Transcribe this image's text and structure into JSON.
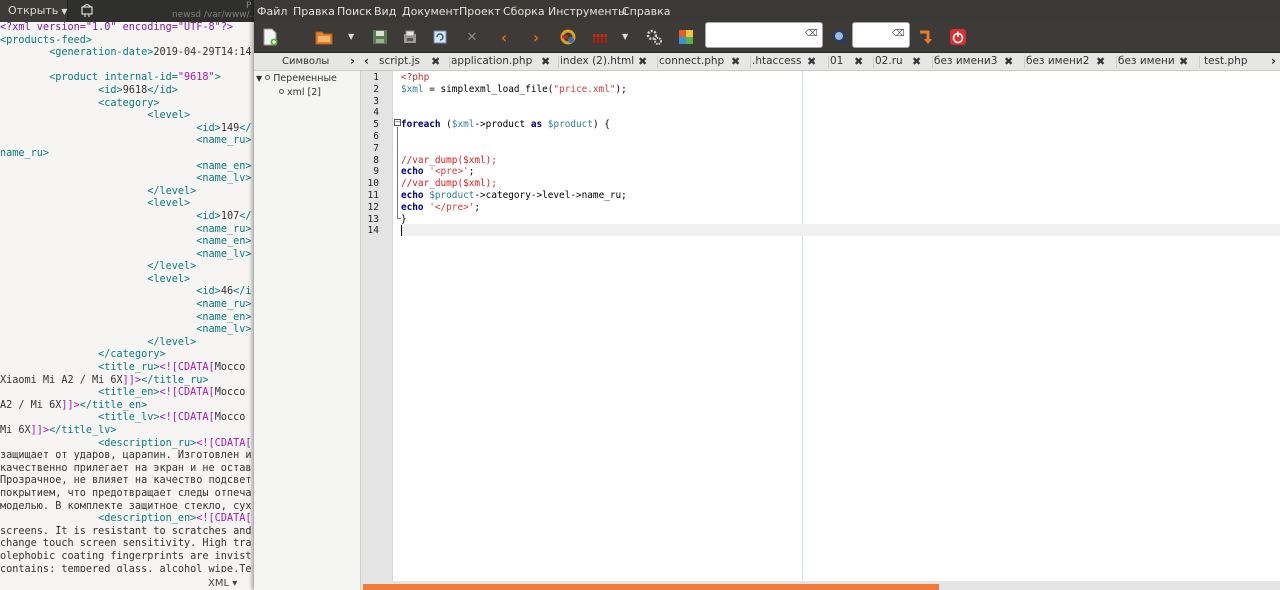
{
  "back_window": {
    "open_button": "Открыть",
    "path_text": "newsd /var/www/...",
    "title_fragment": "Р",
    "language": "XML ▾",
    "xml_lines": [
      {
        "s": [
          [
            "t-pi",
            "<?xml version=\"1.0\" encoding=\"UTF-8\"?>"
          ]
        ]
      },
      {
        "s": [
          [
            "t-tag",
            "<products-feed>"
          ]
        ]
      },
      {
        "s": [
          [
            "t-plain",
            "        "
          ],
          [
            "t-tag",
            "<generation-date>"
          ],
          [
            "t-plain",
            "2019-04-29T14:14"
          ]
        ]
      },
      {
        "s": [
          [
            "t-plain",
            ""
          ]
        ]
      },
      {
        "s": [
          [
            "t-plain",
            "        "
          ],
          [
            "t-tag",
            "<product "
          ],
          [
            "t-attr",
            "internal-id="
          ],
          [
            "t-str",
            "\"9618\""
          ],
          [
            "t-tag",
            ">"
          ]
        ]
      },
      {
        "s": [
          [
            "t-plain",
            "                "
          ],
          [
            "t-tag",
            "<id>"
          ],
          [
            "t-plain",
            "9618"
          ],
          [
            "t-tag",
            "</id>"
          ]
        ]
      },
      {
        "s": [
          [
            "t-plain",
            "                "
          ],
          [
            "t-tag",
            "<category>"
          ]
        ]
      },
      {
        "s": [
          [
            "t-plain",
            "                        "
          ],
          [
            "t-tag",
            "<level>"
          ]
        ]
      },
      {
        "s": [
          [
            "t-plain",
            "                                "
          ],
          [
            "t-tag",
            "<id>"
          ],
          [
            "t-plain",
            "149"
          ],
          [
            "t-tag",
            "</"
          ]
        ]
      },
      {
        "s": [
          [
            "t-plain",
            "                                "
          ],
          [
            "t-tag",
            "<name_ru>"
          ]
        ]
      },
      {
        "s": [
          [
            "t-tag",
            "name_ru>"
          ]
        ]
      },
      {
        "s": [
          [
            "t-plain",
            "                                "
          ],
          [
            "t-tag",
            "<name_en>"
          ]
        ]
      },
      {
        "s": [
          [
            "t-plain",
            "                                "
          ],
          [
            "t-tag",
            "<name_lv>"
          ]
        ]
      },
      {
        "s": [
          [
            "t-plain",
            "                        "
          ],
          [
            "t-tag",
            "</level>"
          ]
        ]
      },
      {
        "s": [
          [
            "t-plain",
            "                        "
          ],
          [
            "t-tag",
            "<level>"
          ]
        ]
      },
      {
        "s": [
          [
            "t-plain",
            "                                "
          ],
          [
            "t-tag",
            "<id>"
          ],
          [
            "t-plain",
            "107"
          ],
          [
            "t-tag",
            "</"
          ]
        ]
      },
      {
        "s": [
          [
            "t-plain",
            "                                "
          ],
          [
            "t-tag",
            "<name_ru>"
          ]
        ]
      },
      {
        "s": [
          [
            "t-plain",
            "                                "
          ],
          [
            "t-tag",
            "<name_en>"
          ]
        ]
      },
      {
        "s": [
          [
            "t-plain",
            "                                "
          ],
          [
            "t-tag",
            "<name_lv>"
          ]
        ]
      },
      {
        "s": [
          [
            "t-plain",
            "                        "
          ],
          [
            "t-tag",
            "</level>"
          ]
        ]
      },
      {
        "s": [
          [
            "t-plain",
            "                        "
          ],
          [
            "t-tag",
            "<level>"
          ]
        ]
      },
      {
        "s": [
          [
            "t-plain",
            "                                "
          ],
          [
            "t-tag",
            "<id>"
          ],
          [
            "t-plain",
            "46"
          ],
          [
            "t-tag",
            "</i"
          ]
        ]
      },
      {
        "s": [
          [
            "t-plain",
            "                                "
          ],
          [
            "t-tag",
            "<name_ru>"
          ]
        ]
      },
      {
        "s": [
          [
            "t-plain",
            "                                "
          ],
          [
            "t-tag",
            "<name_en>"
          ]
        ]
      },
      {
        "s": [
          [
            "t-plain",
            "                                "
          ],
          [
            "t-tag",
            "<name_lv>"
          ]
        ]
      },
      {
        "s": [
          [
            "t-plain",
            "                        "
          ],
          [
            "t-tag",
            "</level>"
          ]
        ]
      },
      {
        "s": [
          [
            "t-plain",
            "                "
          ],
          [
            "t-tag",
            "</category>"
          ]
        ]
      },
      {
        "s": [
          [
            "t-plain",
            "                "
          ],
          [
            "t-tag",
            "<title_ru>"
          ],
          [
            "t-cdata",
            "<![CDATA["
          ],
          [
            "t-plain",
            "Моссо"
          ]
        ]
      },
      {
        "s": [
          [
            "t-plain",
            "Xiaomi Mi A2 / Mi 6X"
          ],
          [
            "t-cdata",
            "]]>"
          ],
          [
            "t-tag",
            "</title_ru>"
          ]
        ]
      },
      {
        "s": [
          [
            "t-plain",
            "                "
          ],
          [
            "t-tag",
            "<title_en>"
          ],
          [
            "t-cdata",
            "<![CDATA["
          ],
          [
            "t-plain",
            "Mocco"
          ]
        ]
      },
      {
        "s": [
          [
            "t-plain",
            "A2 / Mi 6X"
          ],
          [
            "t-cdata",
            "]]>"
          ],
          [
            "t-tag",
            "</title_en>"
          ]
        ]
      },
      {
        "s": [
          [
            "t-plain",
            "                "
          ],
          [
            "t-tag",
            "<title_lv>"
          ],
          [
            "t-cdata",
            "<![CDATA["
          ],
          [
            "t-plain",
            "Mocco"
          ]
        ]
      },
      {
        "s": [
          [
            "t-plain",
            "Mi 6X"
          ],
          [
            "t-cdata",
            "]]>"
          ],
          [
            "t-tag",
            "</title_lv>"
          ]
        ]
      },
      {
        "s": [
          [
            "t-plain",
            "                "
          ],
          [
            "t-tag",
            "<description_ru>"
          ],
          [
            "t-cdata",
            "<![CDATA["
          ]
        ]
      },
      {
        "s": [
          [
            "t-plain",
            "защищает от ударов, царапин. Изготовлен и"
          ]
        ]
      },
      {
        "s": [
          [
            "t-plain",
            "качественно прилегает на экран и не остав"
          ]
        ]
      },
      {
        "s": [
          [
            "t-plain",
            "Прозрачное, не влияет на качество подсвет"
          ]
        ]
      },
      {
        "s": [
          [
            "t-plain",
            "покрытием, что предотвращает следы отпеча"
          ]
        ]
      },
      {
        "s": [
          [
            "t-plain",
            "моделью. В комплекте защитное стекло, сух"
          ]
        ]
      },
      {
        "s": [
          [
            "t-plain",
            "                "
          ],
          [
            "t-tag",
            "<description_en>"
          ],
          [
            "t-cdata",
            "<![CDATA["
          ]
        ]
      },
      {
        "s": [
          [
            "t-plain",
            "screens. It is resistant to scratches and"
          ]
        ]
      },
      {
        "s": [
          [
            "t-plain",
            "change touch screen sensitivity. High tra"
          ]
        ]
      },
      {
        "s": [
          [
            "t-plain",
            "olephobic coating fingerprints are invist"
          ]
        ]
      },
      {
        "s": [
          [
            "t-plain",
            "contains: tempered glass, alcohol wipe.Te"
          ]
        ]
      }
    ]
  },
  "menubar": {
    "items": [
      "Файл",
      "Правка",
      "Поиск",
      "Вид",
      "Документ",
      "Проект",
      "Сборка",
      "Инструменты",
      "Справка"
    ]
  },
  "toolbar": {
    "search_value": "",
    "goto_value": ""
  },
  "sidebar": {
    "tab_label": "Символы",
    "tree_root": "Переменные",
    "tree_child": "xml [2]"
  },
  "tabs": [
    "script.js",
    "application.php",
    "index (2).html",
    "connect.php",
    ".htaccess",
    "01",
    "02.ru",
    "без имени3",
    "без имени2",
    "без имени",
    "test.php"
  ],
  "editor": {
    "line_numbers": [
      "1",
      "2",
      "3",
      "4",
      "5",
      "6",
      "7",
      "8",
      "9",
      "10",
      "11",
      "12",
      "13",
      "14"
    ],
    "lines": [
      {
        "s": [
          [
            "c-php",
            "<?php"
          ]
        ]
      },
      {
        "s": [
          [
            "c-var",
            "$xml"
          ],
          [
            "c-op",
            " = simplexml_load_file("
          ],
          [
            "c-str",
            "\"price.xml\""
          ],
          [
            "c-op",
            ");"
          ]
        ]
      },
      {
        "s": [
          [
            "c-op",
            ""
          ]
        ]
      },
      {
        "s": [
          [
            "c-op",
            ""
          ]
        ]
      },
      {
        "s": [
          [
            "c-kw",
            "foreach"
          ],
          [
            "c-op",
            " ("
          ],
          [
            "c-var",
            "$xml"
          ],
          [
            "c-op",
            "->product "
          ],
          [
            "c-kw",
            "as"
          ],
          [
            "c-op",
            " "
          ],
          [
            "c-var",
            "$product"
          ],
          [
            "c-op",
            ") {"
          ]
        ]
      },
      {
        "s": [
          [
            "c-op",
            ""
          ]
        ]
      },
      {
        "s": [
          [
            "c-op",
            ""
          ]
        ]
      },
      {
        "s": [
          [
            "c-cmt",
            "//var_dump($xml);"
          ]
        ]
      },
      {
        "s": [
          [
            "c-kw",
            "echo"
          ],
          [
            "c-op",
            " "
          ],
          [
            "c-str",
            "'<pre>'"
          ],
          [
            "c-op",
            ";"
          ]
        ]
      },
      {
        "s": [
          [
            "c-cmt",
            "//var_dump($xml);"
          ]
        ]
      },
      {
        "s": [
          [
            "c-kw",
            "echo"
          ],
          [
            "c-op",
            " "
          ],
          [
            "c-var",
            "$product"
          ],
          [
            "c-op",
            "->category->level->name_ru;"
          ]
        ]
      },
      {
        "s": [
          [
            "c-kw",
            "echo"
          ],
          [
            "c-op",
            " "
          ],
          [
            "c-str",
            "'</pre>'"
          ],
          [
            "c-op",
            ";"
          ]
        ]
      },
      {
        "s": [
          [
            "c-op",
            "}"
          ]
        ]
      },
      {
        "s": [
          [
            "c-op",
            ""
          ]
        ]
      }
    ]
  },
  "colors": {
    "accent_scrollbar": "#ef7a3e",
    "menubar_bg": "#3a3935",
    "keyword": "#00007f",
    "string": "#d23b3b"
  },
  "icons": [
    "new-file-icon",
    "open-file-icon",
    "save-icon",
    "save-all-icon",
    "revert-icon",
    "close-file-icon",
    "back-icon",
    "forward-icon",
    "compile-icon",
    "build-icon",
    "execute-icon",
    "preferences-icon",
    "color-chooser-icon",
    "find-icon",
    "jump-to-line-icon",
    "quit-icon"
  ]
}
